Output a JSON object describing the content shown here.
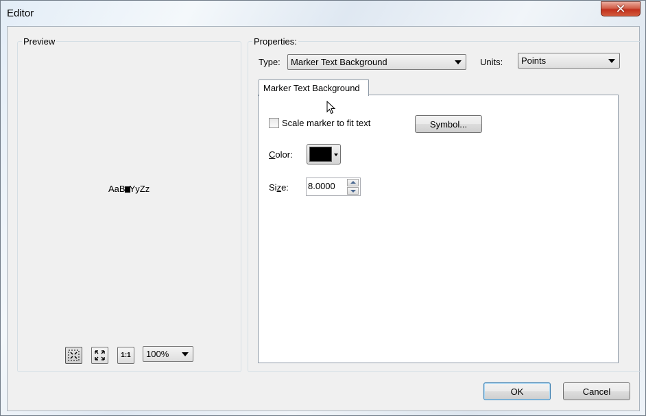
{
  "window": {
    "title": "Editor",
    "close_icon": "close-icon"
  },
  "preview": {
    "group_label": "Preview",
    "sample_left": "AaB",
    "sample_right": "YyZz",
    "zoom_value": "100%",
    "buttons": {
      "fit": "fit-icon",
      "full_extent": "full-extent-icon",
      "actual_size_label": "1:1"
    }
  },
  "properties": {
    "group_label": "Properties:",
    "type_label": "Type:",
    "type_value": "Marker Text Background",
    "units_label": "Units:",
    "units_value": "Points",
    "tab_label": "Marker Text Background",
    "scale_checkbox_label": "Scale marker to fit text",
    "scale_checked": false,
    "symbol_button": "Symbol...",
    "color_label_mnemonic": "C",
    "color_label_rest": "olor:",
    "color_value": "#000000",
    "size_label_prefix": "Si",
    "size_label_mnemonic": "z",
    "size_label_rest": "e:",
    "size_value": "8.0000"
  },
  "footer": {
    "ok_label": "OK",
    "cancel_label": "Cancel"
  }
}
